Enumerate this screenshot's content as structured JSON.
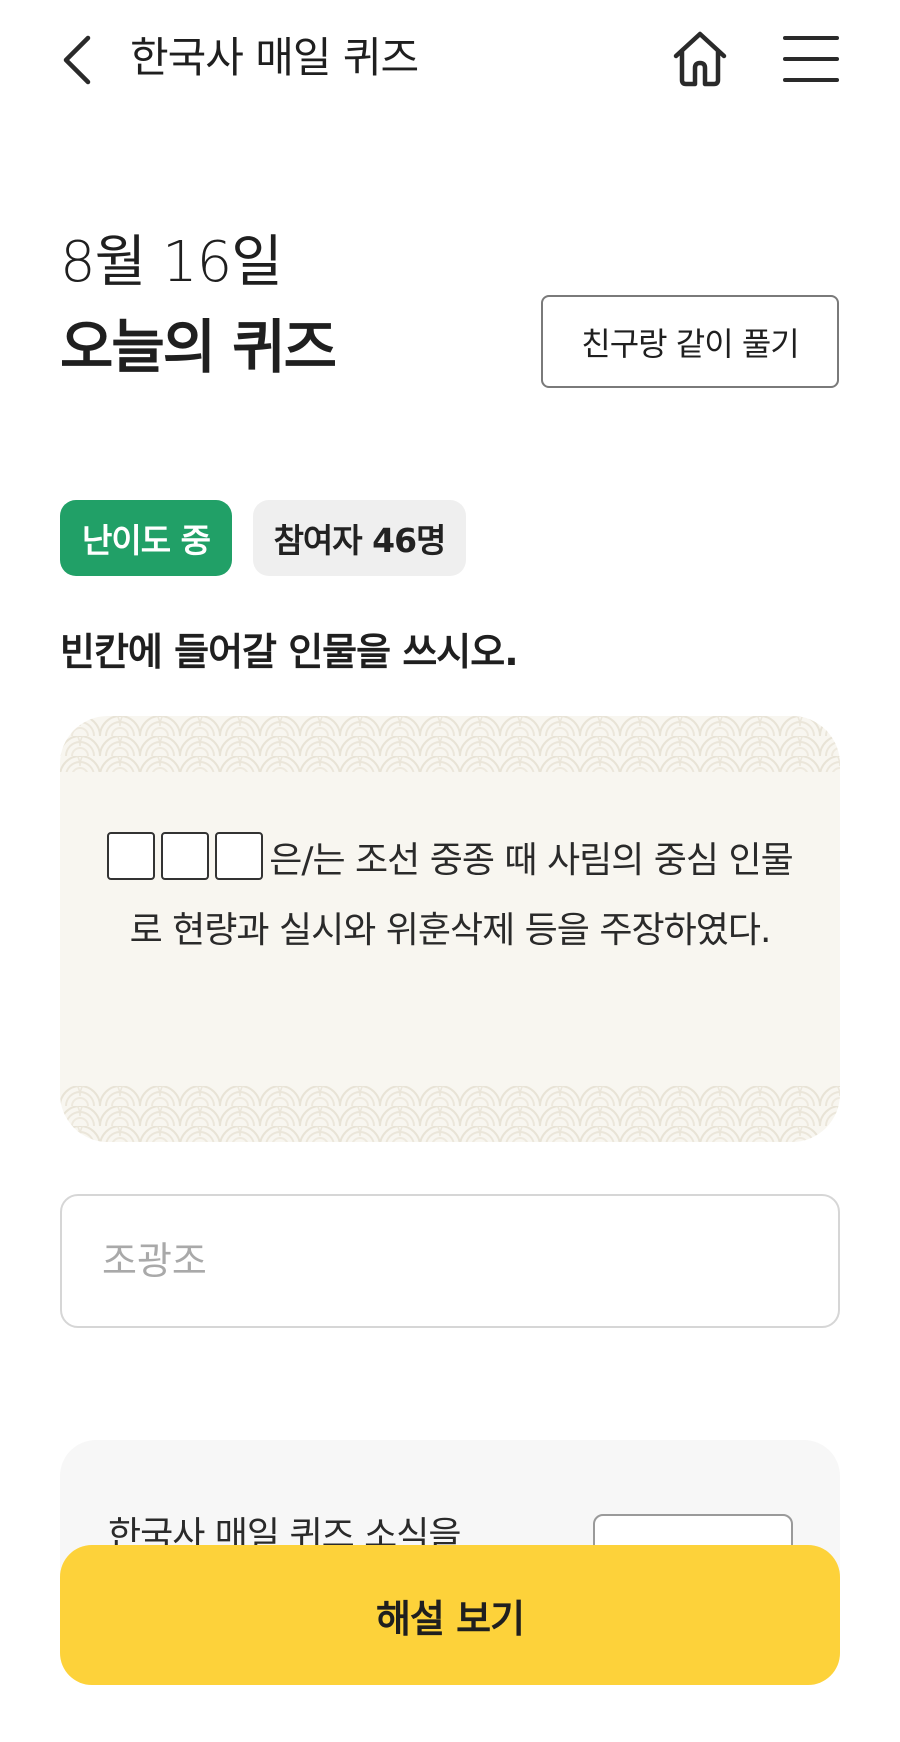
{
  "header": {
    "title": "한국사 매일 퀴즈",
    "back_icon": "chevron-left-icon",
    "home_icon": "home-icon",
    "menu_icon": "hamburger-menu-icon"
  },
  "quiz": {
    "date": "8월 16일",
    "title": "오늘의 퀴즈",
    "friend_button": "친구랑 같이 풀기",
    "difficulty_badge": "난이도 중",
    "participants_badge": "참여자 46명",
    "question": "빈칸에 들어갈 인물을 쓰시오.",
    "passage": "은/는 조선 중종 때 사림의 중심 인물로 현량과 실시와 위훈삭제 등을 주장하였다.",
    "answer_value": "",
    "answer_placeholder": "조광조"
  },
  "news": {
    "text": "한국사 매일 퀴즈 소식을"
  },
  "bottom": {
    "explain_button": "해설 보기"
  },
  "colors": {
    "difficulty_green": "#21a067",
    "cta_yellow": "#fdd23a",
    "card_bg": "#f8f6f0"
  }
}
